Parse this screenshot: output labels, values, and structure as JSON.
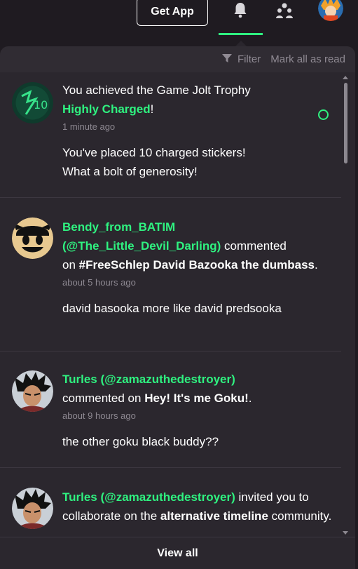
{
  "topbar": {
    "get_app_label": "Get App",
    "icons": [
      "bell-icon",
      "friends-icon",
      "user-avatar"
    ],
    "accent_color": "#2ff280"
  },
  "panel": {
    "filter_label": "Filter",
    "mark_all_label": "Mark all as read",
    "view_all_label": "View all"
  },
  "notifications": [
    {
      "line1": "You achieved the Game Jolt Trophy",
      "highlight": "Highly Charged",
      "suffix": "!",
      "time": "1 minute ago",
      "body_line1": "You've placed 10 charged stickers!",
      "body_line2": "What a bolt of generosity!",
      "unread": true
    },
    {
      "user": "Bendy_from_BATIM",
      "handle": "(@The_Little_Devil_Darling)",
      "action": "commented",
      "prep": "on",
      "target": "#FreeSchlep David Bazooka the dumbass",
      "end": ".",
      "time": "about 5 hours ago",
      "body": "david basooka more like david predsooka"
    },
    {
      "user_handle": "Turles (@zamazuthedestroyer)",
      "action": "commented on",
      "target": "Hey! It's me Goku!",
      "end": ".",
      "time": "about 9 hours ago",
      "body": "the other goku black buddy??"
    },
    {
      "user_handle": "Turles (@zamazuthedestroyer)",
      "action": "invited you to collaborate on the",
      "target": "alternative timeline",
      "end": "community."
    }
  ]
}
